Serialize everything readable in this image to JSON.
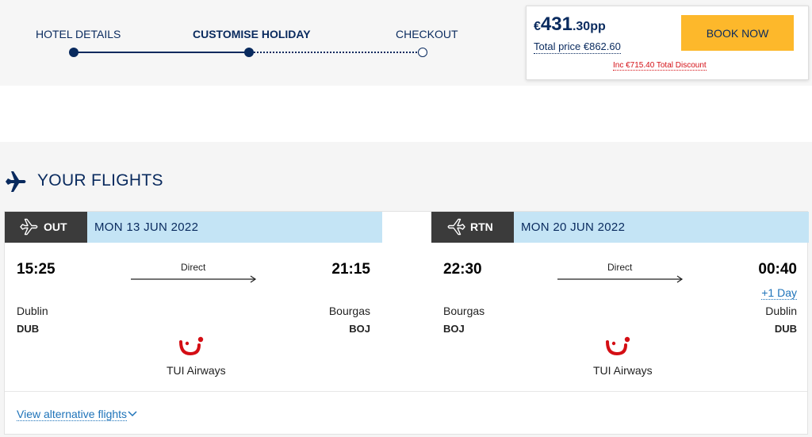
{
  "progress": {
    "steps": [
      {
        "label": "HOTEL DETAILS",
        "state": "complete"
      },
      {
        "label": "CUSTOMISE HOLIDAY",
        "state": "current"
      },
      {
        "label": "CHECKOUT",
        "state": "upcoming"
      }
    ]
  },
  "price": {
    "currency": "€",
    "whole": "431",
    "fraction": ".30",
    "suffix": "pp",
    "total": "Total price €862.60",
    "discount": "Inc €715.40 Total Discount",
    "book_label": "BOOK NOW"
  },
  "flights": {
    "title": "YOUR FLIGHTS",
    "outbound": {
      "tag": "OUT",
      "date": "MON 13 JUN 2022",
      "depart_time": "15:25",
      "arrive_time": "21:15",
      "stops": "Direct",
      "from_city": "Dublin",
      "from_code": "DUB",
      "to_city": "Bourgas",
      "to_code": "BOJ",
      "airline": "TUI Airways"
    },
    "return": {
      "tag": "RTN",
      "date": "MON 20 JUN 2022",
      "depart_time": "22:30",
      "arrive_time": "00:40",
      "day_offset": "+1 Day",
      "stops": "Direct",
      "from_city": "Bourgas",
      "from_code": "BOJ",
      "to_city": "Dublin",
      "to_code": "DUB",
      "airline": "TUI Airways"
    },
    "alt_link": "View alternative flights"
  },
  "colors": {
    "navy": "#092a5e",
    "book_button": "#fdb82b",
    "discount_red": "#d40e14",
    "date_bar": "#c4e4f5",
    "tag_bg": "#3b3b3b",
    "link_blue": "#1e73b9",
    "tui_red": "#d40e14"
  },
  "icons": [
    "airplane-icon",
    "plane-depart-icon",
    "plane-return-icon",
    "arrow-right-icon",
    "tui-smile-logo",
    "chevron-down-icon"
  ]
}
